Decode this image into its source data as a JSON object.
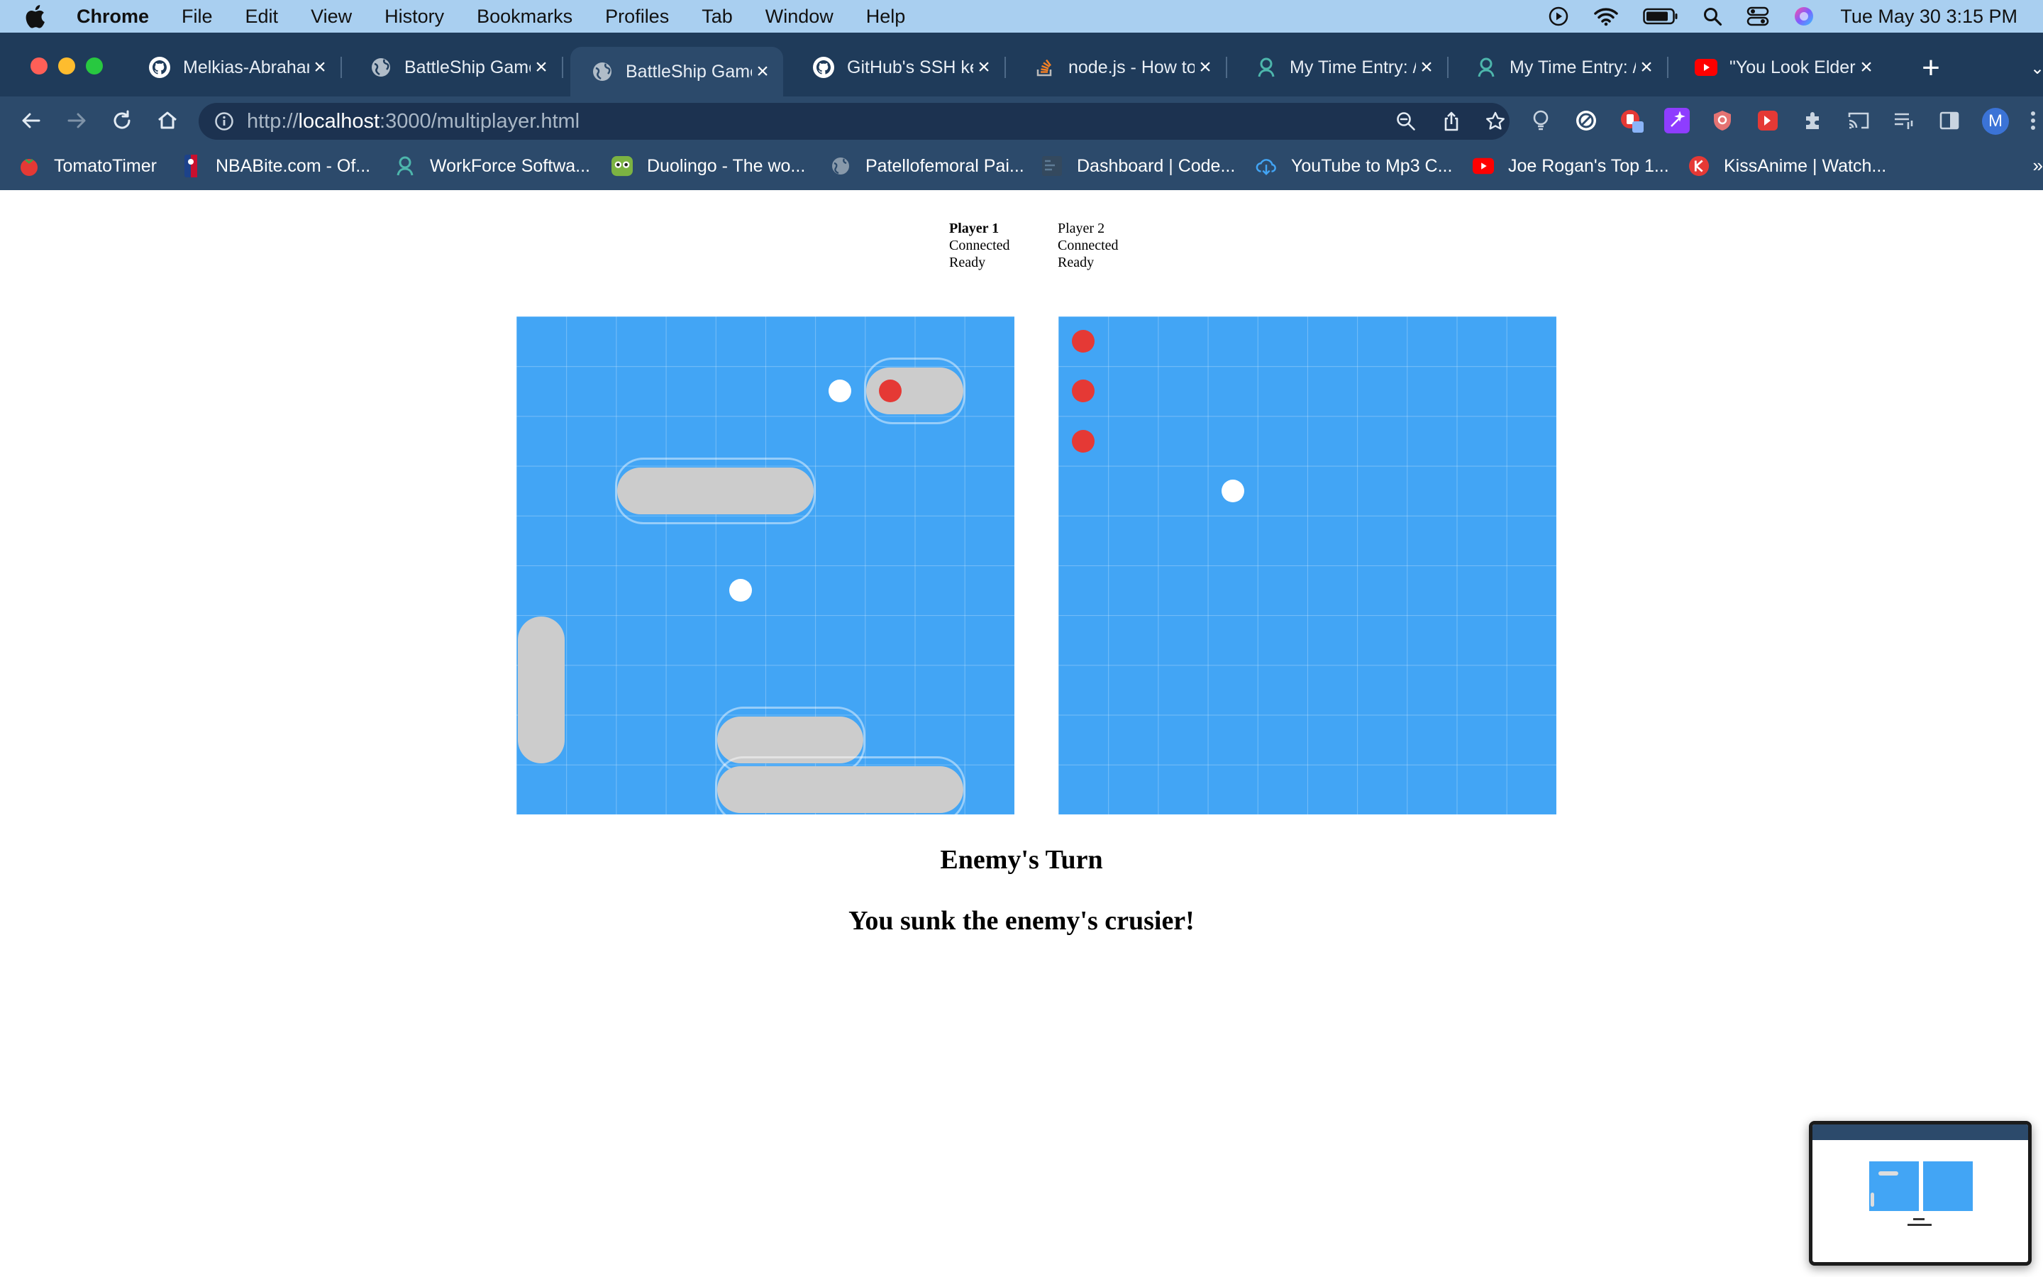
{
  "menubar": {
    "app_name": "Chrome",
    "items": [
      "File",
      "Edit",
      "View",
      "History",
      "Bookmarks",
      "Profiles",
      "Tab",
      "Window",
      "Help"
    ],
    "clock": "Tue May 30  3:15 PM"
  },
  "tabs": [
    {
      "title": "Melkias-Abraham",
      "icon": "github-icon",
      "active": false
    },
    {
      "title": "BattleShip Game",
      "icon": "globe-icon",
      "active": false
    },
    {
      "title": "BattleShip Game",
      "icon": "globe-icon",
      "active": true
    },
    {
      "title": "GitHub's SSH ke",
      "icon": "github-icon",
      "active": false
    },
    {
      "title": "node.js - How to",
      "icon": "stackoverflow-icon",
      "active": false
    },
    {
      "title": "My Time Entry: /",
      "icon": "workforce-icon",
      "active": false
    },
    {
      "title": "My Time Entry: /",
      "icon": "workforce-icon",
      "active": false
    },
    {
      "title": "\"You Look Elder",
      "icon": "youtube-icon",
      "active": false
    }
  ],
  "omnibox": {
    "scheme": "http://",
    "host": "localhost",
    "rest": ":3000/multiplayer.html"
  },
  "profile": {
    "initial": "M"
  },
  "bookmarks": [
    {
      "label": "TomatoTimer",
      "icon": "tomato-icon",
      "color": "#e53935"
    },
    {
      "label": "NBABite.com - Of...",
      "icon": "nba-icon",
      "color": "#c62828"
    },
    {
      "label": "WorkForce Softwa...",
      "icon": "workforce-icon",
      "color": "#4db6ac"
    },
    {
      "label": "Duolingo - The wo...",
      "icon": "duolingo-icon",
      "color": "#7cb342"
    },
    {
      "label": "Patellofemoral Pai...",
      "icon": "globe-icon",
      "color": "#8899aa"
    },
    {
      "label": "Dashboard | Code...",
      "icon": "code-icon",
      "color": "#34495e"
    },
    {
      "label": "YouTube to Mp3 C...",
      "icon": "cloud-download-icon",
      "color": "#42a5f5"
    },
    {
      "label": "Joe Rogan's Top 1...",
      "icon": "youtube-icon",
      "color": "#e53935"
    },
    {
      "label": "KissAnime | Watch...",
      "icon": "kissanime-icon",
      "color": "#e53935"
    }
  ],
  "players": [
    {
      "name": "Player 1",
      "status": "Connected",
      "ready": "Ready",
      "bold": true
    },
    {
      "name": "Player 2",
      "status": "Connected",
      "ready": "Ready",
      "bold": false
    }
  ],
  "boards": {
    "colors": {
      "water": "#42a5f5",
      "ship": "#cccccc",
      "hit": "#e53935",
      "miss": "#ffffff"
    },
    "player": {
      "ships": [
        {
          "name": "destroyer",
          "row": 1,
          "col": 7,
          "length": 2,
          "orientation": "horizontal",
          "highlight": true
        },
        {
          "name": "submarine",
          "row": 3,
          "col": 2,
          "length": 4,
          "orientation": "horizontal",
          "highlight": true
        },
        {
          "name": "cruiser",
          "row": 6,
          "col": 0,
          "length": 3,
          "orientation": "vertical",
          "highlight": false
        },
        {
          "name": "battleship",
          "row": 8,
          "col": 4,
          "length": 3,
          "orientation": "horizontal",
          "highlight": true
        },
        {
          "name": "carrier",
          "row": 9,
          "col": 4,
          "length": 5,
          "orientation": "horizontal",
          "highlight": true
        }
      ],
      "shots": [
        {
          "row": 1,
          "col": 6,
          "result": "miss"
        },
        {
          "row": 1,
          "col": 7,
          "result": "hit"
        },
        {
          "row": 5,
          "col": 4,
          "result": "miss"
        }
      ]
    },
    "enemy": {
      "ships": [],
      "shots": [
        {
          "row": 0,
          "col": 0,
          "result": "hit"
        },
        {
          "row": 1,
          "col": 0,
          "result": "hit"
        },
        {
          "row": 2,
          "col": 0,
          "result": "hit"
        },
        {
          "row": 3,
          "col": 3,
          "result": "miss"
        }
      ]
    }
  },
  "turn_display": "Enemy's Turn",
  "info_display": "You sunk the enemy's crusier!"
}
